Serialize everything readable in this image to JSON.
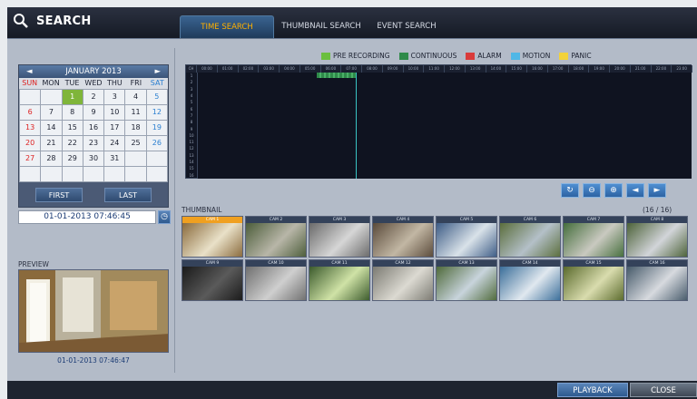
{
  "header": {
    "title": "SEARCH",
    "tabs": [
      {
        "label": "TIME SEARCH",
        "active": true
      },
      {
        "label": "THUMBNAIL SEARCH",
        "active": false
      },
      {
        "label": "EVENT SEARCH",
        "active": false
      }
    ]
  },
  "legend": [
    {
      "label": "PRE RECORDING",
      "color": "#6bbf3f"
    },
    {
      "label": "CONTINUOUS",
      "color": "#2f8a4a"
    },
    {
      "label": "ALARM",
      "color": "#d93b3b"
    },
    {
      "label": "MOTION",
      "color": "#4fb7e6"
    },
    {
      "label": "PANIC",
      "color": "#f2d23a"
    }
  ],
  "calendar": {
    "month_label": "JANUARY 2013",
    "prev": "◄",
    "next": "►",
    "weekdays": [
      "SUN",
      "MON",
      "TUE",
      "WED",
      "THU",
      "FRI",
      "SAT"
    ],
    "days": [
      "",
      "",
      "1",
      "2",
      "3",
      "4",
      "5",
      "6",
      "7",
      "8",
      "9",
      "10",
      "11",
      "12",
      "13",
      "14",
      "15",
      "16",
      "17",
      "18",
      "19",
      "20",
      "21",
      "22",
      "23",
      "24",
      "25",
      "26",
      "27",
      "28",
      "29",
      "30",
      "31",
      "",
      "",
      "",
      "",
      "",
      "",
      "",
      "",
      ""
    ],
    "selected_day": "1",
    "first_label": "FIRST",
    "last_label": "LAST"
  },
  "datetime": "01-01-2013 07:46:45",
  "preview": {
    "label": "PREVIEW",
    "time": "01-01-2013  07:46:47"
  },
  "timeline": {
    "hours": [
      "00:00",
      "01:00",
      "02:00",
      "03:00",
      "04:00",
      "05:00",
      "06:00",
      "07:00",
      "08:00",
      "09:00",
      "10:00",
      "11:00",
      "12:00",
      "13:00",
      "14:00",
      "15:00",
      "16:00",
      "17:00",
      "18:00",
      "19:00",
      "20:00",
      "21:00",
      "22:00",
      "23:00"
    ],
    "cameras": [
      "1",
      "2",
      "3",
      "4",
      "5",
      "6",
      "7",
      "8",
      "9",
      "10",
      "11",
      "12",
      "13",
      "14",
      "15",
      "16"
    ],
    "corner_label": "CH"
  },
  "controls": {
    "refresh_icon": "↻",
    "zoom_out_icon": "⊖",
    "zoom_in_icon": "⊕",
    "prev_icon": "◄",
    "next_icon": "►"
  },
  "thumbnails": {
    "label": "THUMBNAIL",
    "count": "(16 / 16)",
    "items": [
      "CAM 1",
      "CAM 2",
      "CAM 3",
      "CAM 4",
      "CAM 5",
      "CAM 6",
      "CAM 7",
      "CAM 8",
      "CAM 9",
      "CAM 10",
      "CAM 11",
      "CAM 12",
      "CAM 13",
      "CAM 14",
      "CAM 15",
      "CAM 16"
    ]
  },
  "footer": {
    "playback": "PLAYBACK",
    "close": "CLOSE"
  }
}
